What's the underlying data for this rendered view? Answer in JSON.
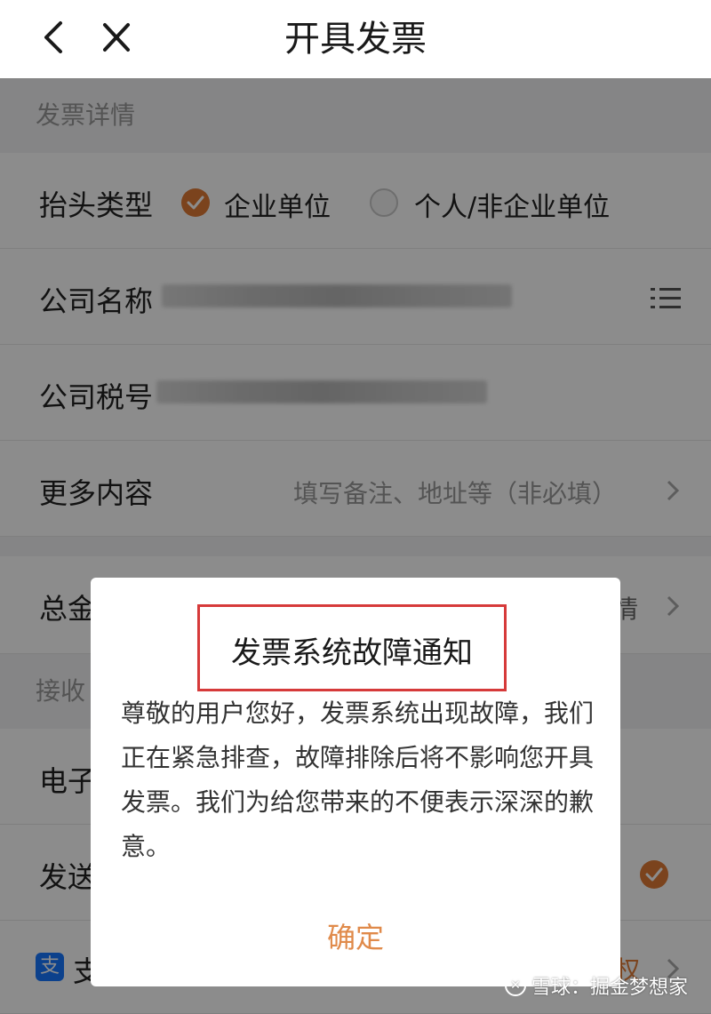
{
  "header": {
    "title": "开具发票"
  },
  "invoice_section": {
    "heading": "发票详情",
    "title_type": {
      "label": "抬头类型",
      "options": [
        {
          "label": "企业单位",
          "selected": true
        },
        {
          "label": "个人/非企业单位",
          "selected": false
        }
      ]
    },
    "company_name_label": "公司名称",
    "tax_id_label": "公司税号",
    "more": {
      "label": "更多内容",
      "hint": "填写备注、地址等（非必填）"
    }
  },
  "total_row": {
    "label_visible": "总金",
    "right_visible": "情"
  },
  "receive_section": {
    "heading_visible": "接收"
  },
  "email_row": {
    "label_visible": "电子"
  },
  "send_row": {
    "label_visible": "发送"
  },
  "alipay_row": {
    "icon_text": "支",
    "label_visible": "支",
    "right_visible": "权"
  },
  "dialog": {
    "title": "发票系统故障通知",
    "body": "尊敬的用户您好，发票系统出现故障，我们正在紧急排查，故障排除后将不影响您开具发票。我们为给您带来的不便表示深深的歉意。",
    "confirm": "确定"
  },
  "watermark": {
    "text": "雪球：掘金梦想家"
  },
  "colors": {
    "accent": "#e07b35",
    "confirm_text": "#e08a4a",
    "highlight_border": "#d63a3a"
  }
}
